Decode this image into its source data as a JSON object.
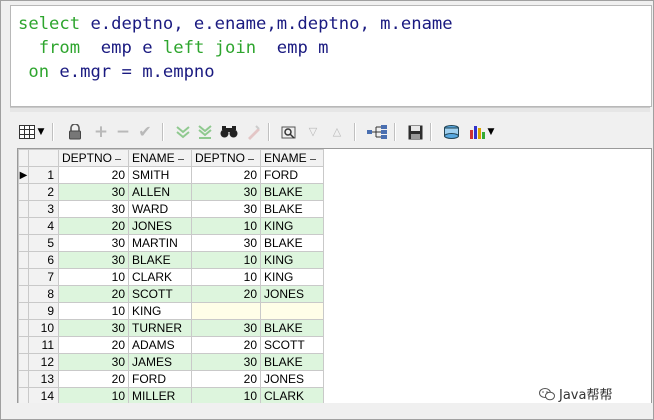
{
  "editor": {
    "line1_select": "select",
    "line1_rest": " e.deptno, e.ename,m.deptno, m.ename",
    "line2_indent": "  ",
    "line2_from": "from",
    "line2_emp": "  emp e ",
    "line2_left": "left",
    "line2_sp": " ",
    "line2_join": "join",
    "line2_rest": "  emp m",
    "line3_indent": " ",
    "line3_on": "on",
    "line3_rest": " e.mgr = m.empno"
  },
  "toolbar": {
    "icons": [
      "grid-view-icon",
      "dropdown-arrow-icon",
      "lock-icon",
      "add-row-icon",
      "delete-row-icon",
      "post-changes-icon",
      "next-record-icon",
      "last-record-icon",
      "find-icon",
      "clear-icon",
      "query-by-example-icon",
      "filter-down-icon",
      "filter-up-icon",
      "link-icon",
      "save-icon",
      "export-icon",
      "chart-icon",
      "chart-dropdown-icon"
    ]
  },
  "grid": {
    "columns": [
      "DEPTNO",
      "ENAME",
      "DEPTNO",
      "ENAME"
    ],
    "rows": [
      {
        "num": "1",
        "c1": "20",
        "c2": "SMITH",
        "c3": "20",
        "c4": "FORD"
      },
      {
        "num": "2",
        "c1": "30",
        "c2": "ALLEN",
        "c3": "30",
        "c4": "BLAKE"
      },
      {
        "num": "3",
        "c1": "30",
        "c2": "WARD",
        "c3": "30",
        "c4": "BLAKE"
      },
      {
        "num": "4",
        "c1": "20",
        "c2": "JONES",
        "c3": "10",
        "c4": "KING"
      },
      {
        "num": "5",
        "c1": "30",
        "c2": "MARTIN",
        "c3": "30",
        "c4": "BLAKE"
      },
      {
        "num": "6",
        "c1": "30",
        "c2": "BLAKE",
        "c3": "10",
        "c4": "KING"
      },
      {
        "num": "7",
        "c1": "10",
        "c2": "CLARK",
        "c3": "10",
        "c4": "KING"
      },
      {
        "num": "8",
        "c1": "20",
        "c2": "SCOTT",
        "c3": "20",
        "c4": "JONES"
      },
      {
        "num": "9",
        "c1": "10",
        "c2": "KING",
        "c3": "",
        "c4": ""
      },
      {
        "num": "10",
        "c1": "30",
        "c2": "TURNER",
        "c3": "30",
        "c4": "BLAKE"
      },
      {
        "num": "11",
        "c1": "20",
        "c2": "ADAMS",
        "c3": "20",
        "c4": "SCOTT"
      },
      {
        "num": "12",
        "c1": "30",
        "c2": "JAMES",
        "c3": "30",
        "c4": "BLAKE"
      },
      {
        "num": "13",
        "c1": "20",
        "c2": "FORD",
        "c3": "20",
        "c4": "JONES"
      },
      {
        "num": "14",
        "c1": "10",
        "c2": "MILLER",
        "c3": "10",
        "c4": "CLARK"
      }
    ],
    "current_row_marker": "▶"
  },
  "watermark": {
    "text": "Java帮帮"
  },
  "colors": {
    "keyword": "#2ea52e",
    "sql_text": "#1a1a80",
    "row_alt": "#ddf5dd"
  }
}
